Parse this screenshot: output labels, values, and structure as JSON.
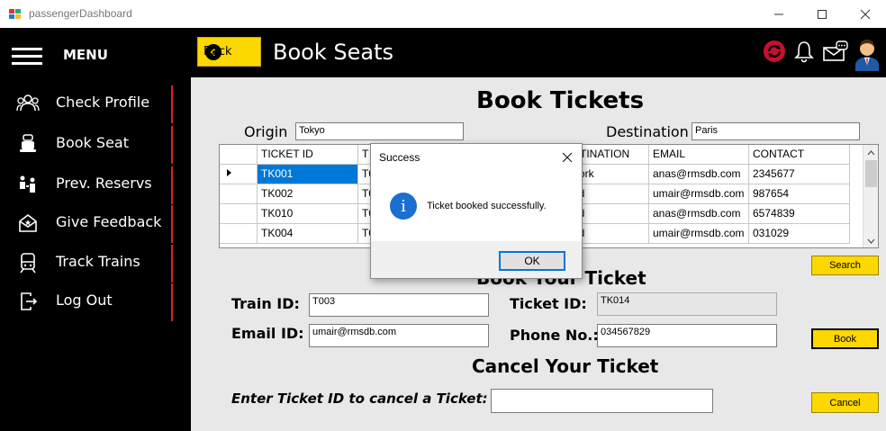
{
  "window": {
    "title": "passengerDashboard"
  },
  "sidebar": {
    "menu_label": "MENU",
    "items": [
      {
        "label": "Check Profile",
        "icon": "users-icon"
      },
      {
        "label": "Book Seat",
        "icon": "seat-icon"
      },
      {
        "label": "Prev. Reservs",
        "icon": "passengers-icon"
      },
      {
        "label": "Give Feedback",
        "icon": "feedback-icon"
      },
      {
        "label": "Track Trains",
        "icon": "train-icon"
      },
      {
        "label": "Log Out",
        "icon": "logout-icon"
      }
    ]
  },
  "header": {
    "back_label": "Back",
    "page_title": "Book Seats"
  },
  "book_tickets": {
    "heading": "Book Tickets",
    "origin_label": "Origin",
    "origin_value": "Tokyo",
    "destination_label": "Destination",
    "destination_value": "Paris"
  },
  "grid": {
    "columns": [
      "TICKET ID",
      "T",
      "",
      "STINATION",
      "EMAIL",
      "CONTACT"
    ],
    "rows": [
      [
        "TK001",
        "T0",
        "",
        "York",
        "anas@rmsdb.com",
        "2345677"
      ],
      [
        "TK002",
        "T0",
        "",
        "rid",
        "umair@rmsdb.com",
        "987654"
      ],
      [
        "TK010",
        "T0",
        "",
        "rid",
        "anas@rmsdb.com",
        "6574839"
      ],
      [
        "TK004",
        "T0",
        "",
        "rid",
        "umair@rmsdb.com",
        "031029"
      ]
    ]
  },
  "search_button": "Search",
  "book_your_ticket": {
    "heading": "Book Your Ticket",
    "train_id_label": "Train ID:",
    "train_id_value": "T003",
    "ticket_id_label": "Ticket ID:",
    "ticket_id_value": "TK014",
    "email_id_label": "Email ID:",
    "email_id_value": "umair@rmsdb.com",
    "phone_label": "Phone No.:",
    "phone_value": "034567829",
    "book_button": "Book"
  },
  "cancel_ticket": {
    "heading": "Cancel Your Ticket",
    "prompt": "Enter Ticket ID to cancel a Ticket:",
    "value": "",
    "cancel_button": "Cancel"
  },
  "dialog": {
    "title": "Success",
    "message": "Ticket booked successfully.",
    "ok_label": "OK"
  },
  "colors": {
    "accent_yellow": "#fdd700",
    "sidebar_black": "#000000",
    "selection_blue": "#0078d7",
    "divider_red": "#dd2222"
  }
}
